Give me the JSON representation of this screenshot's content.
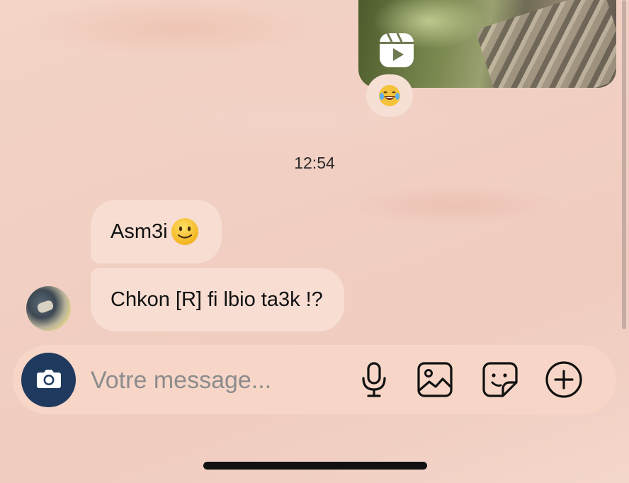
{
  "thread": {
    "media_reaction": "😂",
    "timestamp": "12:54",
    "messages": [
      {
        "text": "Asm3i",
        "emoji": "🙂"
      },
      {
        "text": "Chkon [R] fi lbio ta3k !?"
      }
    ]
  },
  "composer": {
    "placeholder": "Votre message..."
  },
  "colors": {
    "camera_button": "#1f3a5e",
    "bubble": "#f7ddd2",
    "composer": "#f7d6c8"
  },
  "icons": [
    "reel-icon",
    "camera-icon",
    "microphone-icon",
    "image-icon",
    "sticker-icon",
    "plus-circle-icon"
  ]
}
